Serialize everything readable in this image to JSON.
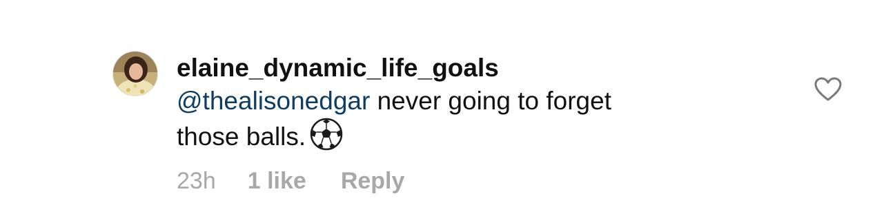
{
  "comment": {
    "username": "elaine_dynamic_life_goals",
    "mention": "@thealisonedgar",
    "text_line1": " never going to forget",
    "text_line2": "those balls.",
    "emoji": "soccer-ball",
    "timestamp": "23h",
    "likes": "1 like",
    "reply_label": "Reply",
    "like_icon": "heart-outline-icon"
  },
  "colors": {
    "text": "#111111",
    "mention": "#0e3d63",
    "meta": "#a8a8a8",
    "icon": "#7a7a7a"
  }
}
